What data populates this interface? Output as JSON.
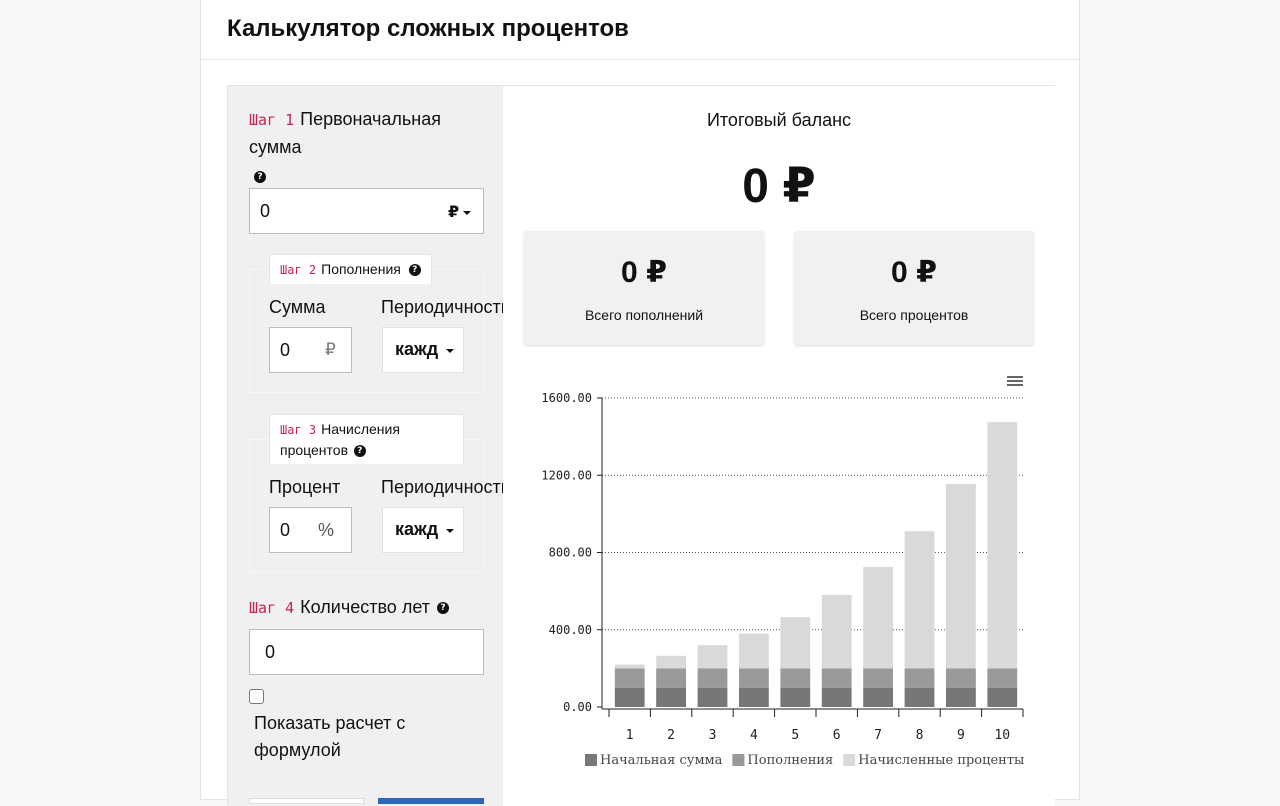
{
  "header": {
    "title": "Калькулятор сложных процентов"
  },
  "step1": {
    "tag": "Шаг 1",
    "title": "Первоначальная сумма",
    "input_value": "0",
    "currency": "₽"
  },
  "step2": {
    "tag": "Шаг 2",
    "title": "Пополнения",
    "amount_label": "Сумма",
    "amount_value": "0",
    "amount_unit": "₽",
    "period_label": "Периодичность",
    "period_value": "кажд"
  },
  "step3": {
    "tag": "Шаг 3",
    "title_line1": "Начисления",
    "title_line2": "процентов",
    "percent_label": "Процент",
    "percent_value": "0",
    "percent_unit": "%",
    "period_label": "Периодичность",
    "period_value": "кажд"
  },
  "step4": {
    "tag": "Шаг 4",
    "title": "Количество лет",
    "input_value": "0",
    "formula_label_line1": "Показать расчет с",
    "formula_label_line2": "формулой"
  },
  "results": {
    "total_label": "Итоговый баланс",
    "total_value": "0 ₽",
    "contrib_value": "0 ₽",
    "contrib_label": "Всего пополнений",
    "interest_value": "0 ₽",
    "interest_label": "Всего процентов"
  },
  "icons": {
    "help": "question-circle-icon",
    "menu": "hamburger-menu-icon",
    "currency_caret": "caret-down-icon"
  },
  "colors": {
    "tag": "#c7254e",
    "initial": "#777777",
    "contrib": "#999999",
    "interest": "#d9d9d9",
    "button": "#2b67b8"
  },
  "chart_data": {
    "type": "bar",
    "stacked": true,
    "categories": [
      "1",
      "2",
      "3",
      "4",
      "5",
      "6",
      "7",
      "8",
      "9",
      "10"
    ],
    "series": [
      {
        "name": "Начальная  сумма",
        "values": [
          100,
          100,
          100,
          100,
          100,
          100,
          100,
          100,
          100,
          100
        ]
      },
      {
        "name": "Пополнения",
        "values": [
          100,
          100,
          100,
          100,
          100,
          100,
          100,
          100,
          100,
          100
        ]
      },
      {
        "name": "Начисленные  проценты",
        "values": [
          20,
          65,
          120,
          180,
          265,
          380,
          525,
          710,
          955,
          1275
        ]
      }
    ],
    "ylim": [
      0,
      1600
    ],
    "yticks": [
      "0.00",
      "400.00",
      "800.00",
      "1200.00",
      "1600.00"
    ],
    "grid": true,
    "legend": "bottom"
  }
}
